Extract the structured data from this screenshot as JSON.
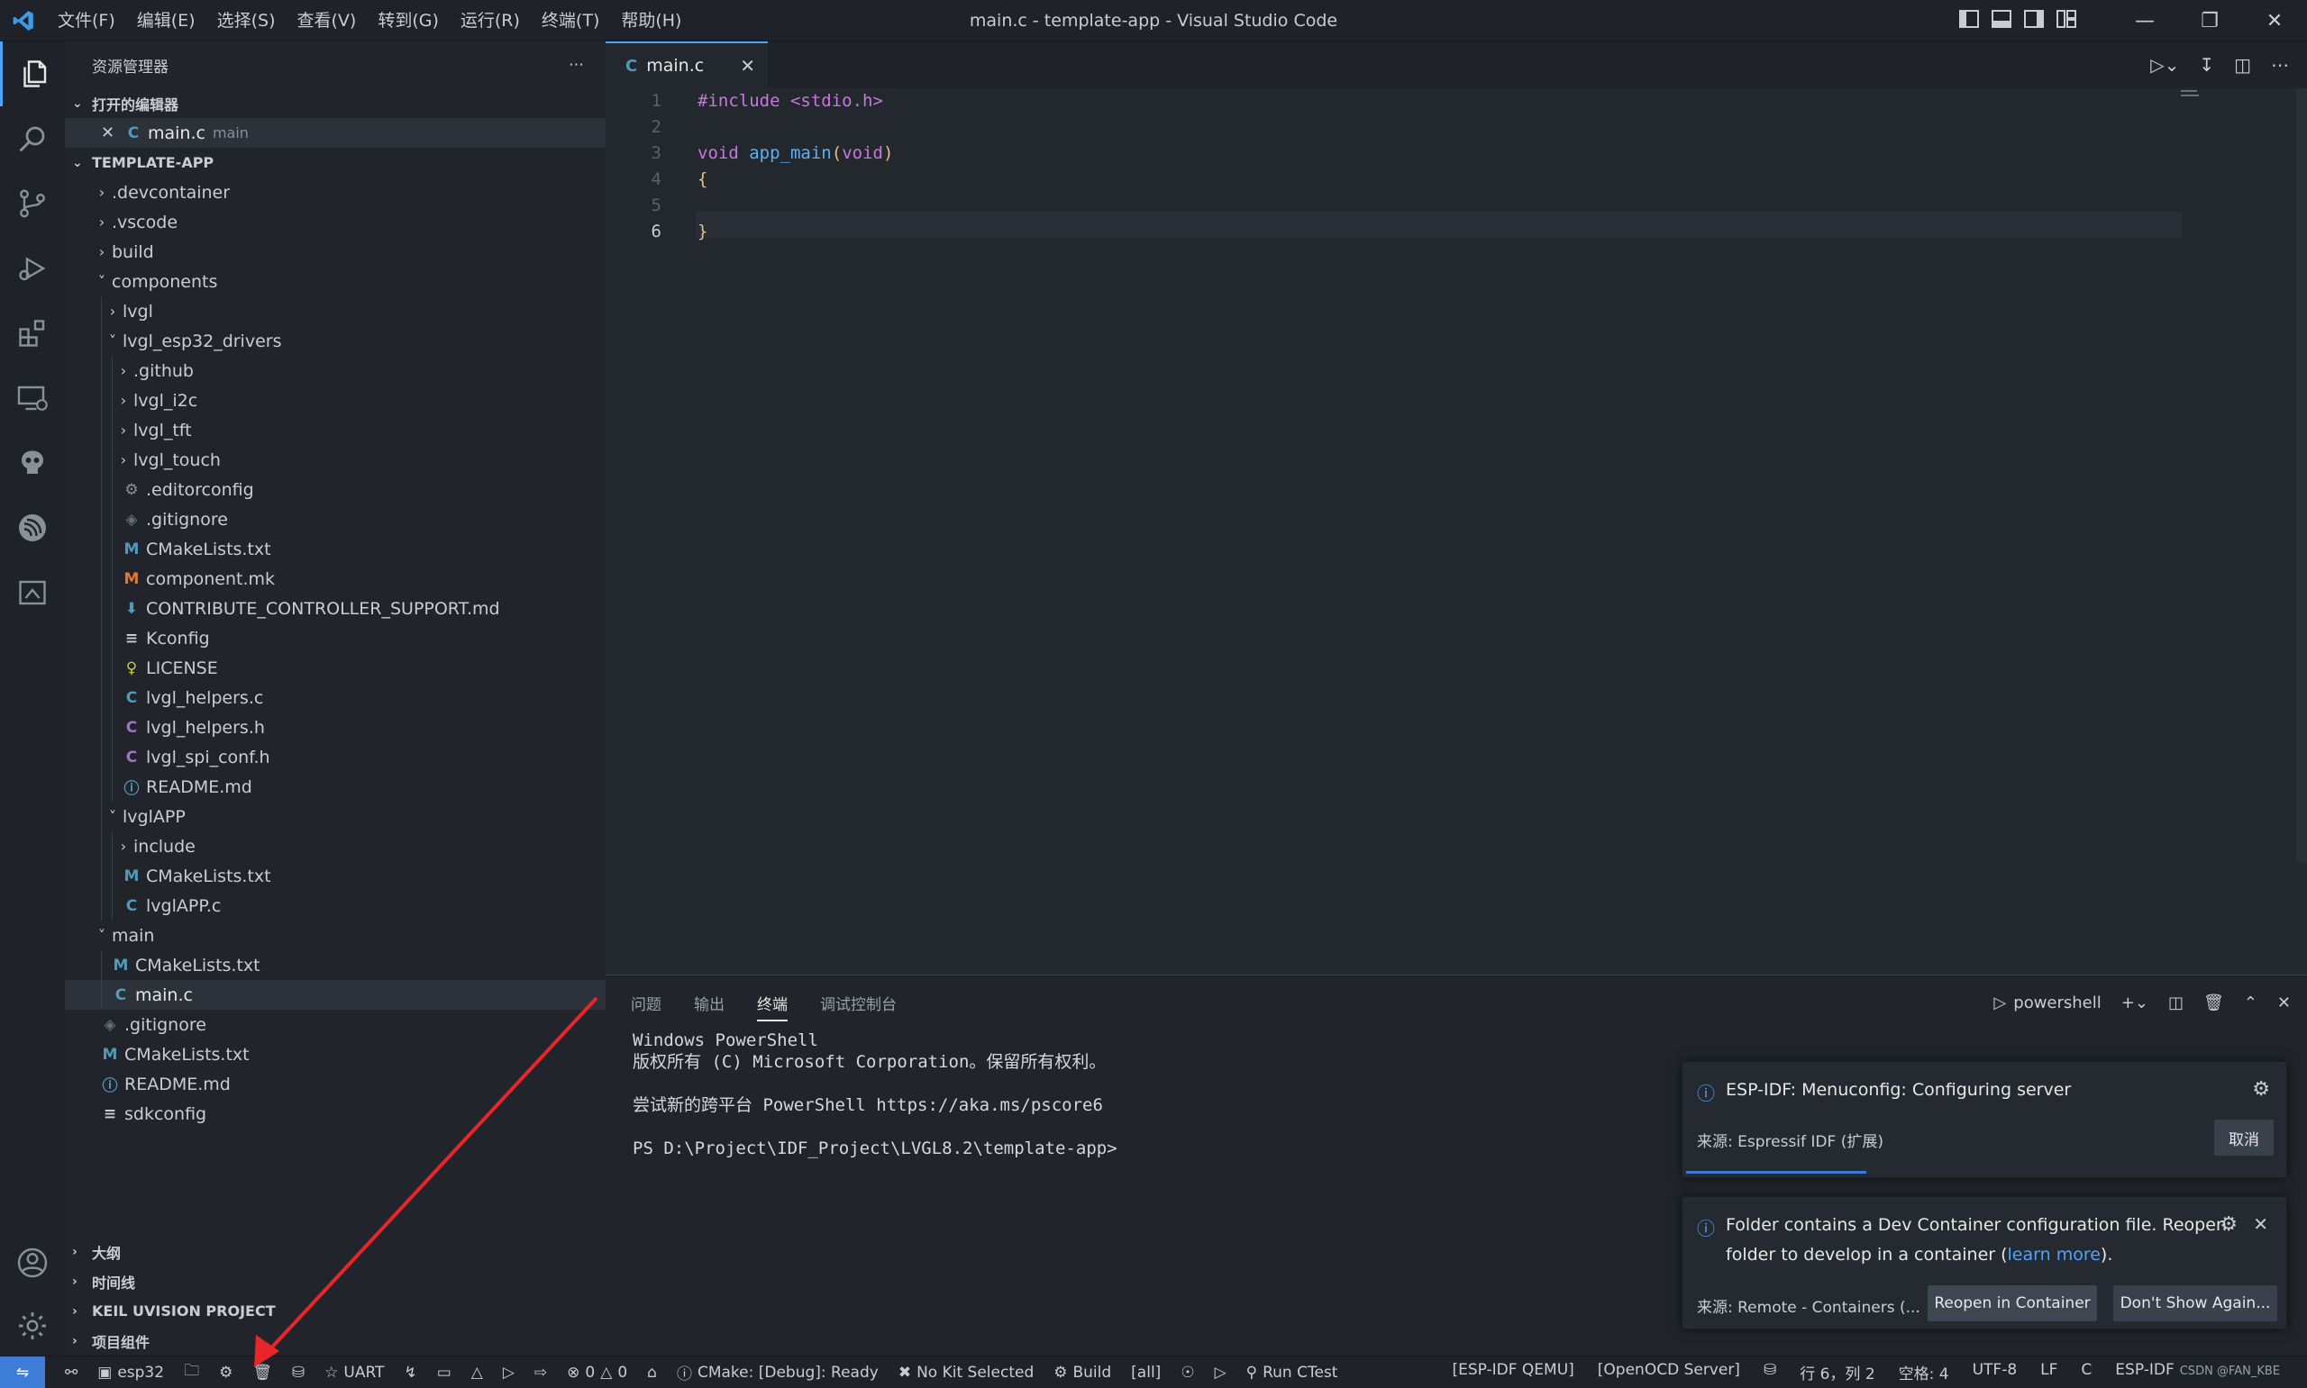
{
  "window": {
    "title": "main.c - template-app - Visual Studio Code",
    "menu": [
      "文件(F)",
      "编辑(E)",
      "选择(S)",
      "查看(V)",
      "转到(G)",
      "运行(R)",
      "终端(T)",
      "帮助(H)"
    ]
  },
  "sidebar": {
    "title": "资源管理器",
    "open_editors_label": "打开的编辑器",
    "open_editor": {
      "name": "main.c",
      "desc": "main"
    },
    "project_label": "TEMPLATE-APP",
    "tree": [
      {
        "label": ".devcontainer"
      },
      {
        "label": ".vscode"
      },
      {
        "label": "build"
      },
      {
        "label": "components"
      },
      {
        "label": "lvgl"
      },
      {
        "label": "lvgl_esp32_drivers"
      },
      {
        "label": ".github"
      },
      {
        "label": "lvgl_i2c"
      },
      {
        "label": "lvgl_tft"
      },
      {
        "label": "lvgl_touch"
      },
      {
        "label": ".editorconfig"
      },
      {
        "label": ".gitignore"
      },
      {
        "label": "CMakeLists.txt"
      },
      {
        "label": "component.mk"
      },
      {
        "label": "CONTRIBUTE_CONTROLLER_SUPPORT.md"
      },
      {
        "label": "Kconfig"
      },
      {
        "label": "LICENSE"
      },
      {
        "label": "lvgl_helpers.c"
      },
      {
        "label": "lvgl_helpers.h"
      },
      {
        "label": "lvgl_spi_conf.h"
      },
      {
        "label": "README.md"
      },
      {
        "label": "lvglAPP"
      },
      {
        "label": "include"
      },
      {
        "label": "CMakeLists.txt"
      },
      {
        "label": "lvglAPP.c"
      },
      {
        "label": "main"
      },
      {
        "label": "CMakeLists.txt"
      },
      {
        "label": "main.c"
      },
      {
        "label": ".gitignore"
      },
      {
        "label": "CMakeLists.txt"
      },
      {
        "label": "README.md"
      },
      {
        "label": "sdkconfig"
      }
    ],
    "bottom_sections": [
      "大纲",
      "时间线",
      "KEIL UVISION PROJECT",
      "项目组件"
    ]
  },
  "editor": {
    "tab": "main.c",
    "tab_icon": "C",
    "line_numbers": [
      "1",
      "2",
      "3",
      "4",
      "5",
      "6"
    ],
    "code": {
      "l1_inc": "#include <stdio.h>",
      "l3_type": "void",
      "l3_fn": "app_main",
      "l3_po": "(",
      "l3_arg": "void",
      "l3_pc": ")",
      "l4": "{",
      "l6": "}"
    }
  },
  "panel": {
    "tabs": [
      "问题",
      "输出",
      "终端",
      "调试控制台"
    ],
    "active_tab": "终端",
    "shell": "powershell",
    "terminal_lines": [
      "Windows PowerShell",
      "版权所有 (C) Microsoft Corporation。保留所有权利。",
      "",
      "尝试新的跨平台 PowerShell https://aka.ms/pscore6",
      "",
      "PS D:\\Project\\IDF_Project\\LVGL8.2\\template-app>"
    ]
  },
  "notifications": [
    {
      "message": "ESP-IDF: Menuconfig: Configuring server",
      "source": "来源: Espressif IDF (扩展)",
      "button": "取消"
    },
    {
      "message_1": "Folder contains a Dev Container configuration file. Reopen",
      "message_2_pre": "folder to develop in a container (",
      "link": "learn more",
      "message_2_post": ").",
      "source": "来源: Remote - Containers (...",
      "button_primary": "Reopen in Container",
      "button_secondary": "Don't Show Again..."
    }
  ],
  "statusbar": {
    "left": [
      "esp32",
      "UART",
      "0",
      "0",
      "CMake: [Debug]: Ready",
      "No Kit Selected",
      "Build",
      "[all]",
      "Run CTest"
    ],
    "right": [
      "[ESP-IDF QEMU]",
      "[OpenOCD Server]",
      "行 6，列 2",
      "空格: 4",
      "UTF-8",
      "LF",
      "C",
      "ESP-IDF"
    ],
    "watermark": "CSDN @FAN_KBE"
  },
  "colors": {
    "accent": "#4fa3ff",
    "annotation_arrow": "#e8262a"
  }
}
